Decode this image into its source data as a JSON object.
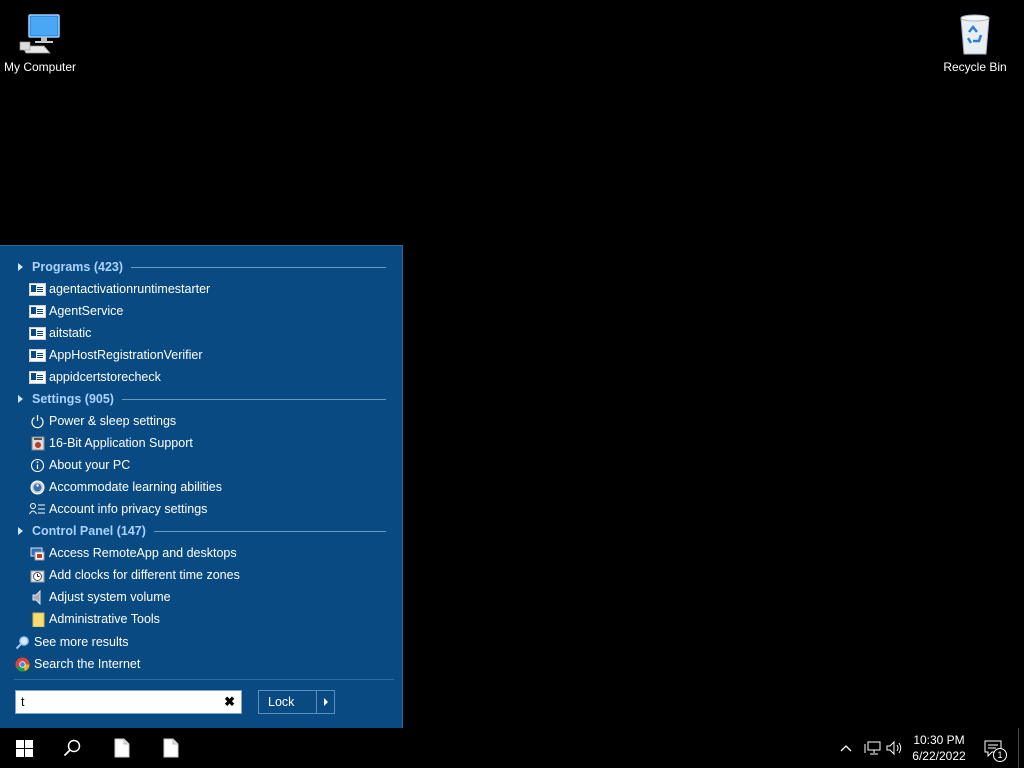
{
  "desktop": {
    "icons": [
      {
        "label": "My Computer",
        "icon": "computer-icon"
      },
      {
        "label": "Recycle Bin",
        "icon": "recycle-bin-icon"
      }
    ]
  },
  "start_menu": {
    "sections": [
      {
        "header": "Programs (423)",
        "items": [
          {
            "label": "agentactivationruntimestarter",
            "icon": "app-icon"
          },
          {
            "label": "AgentService",
            "icon": "app-icon"
          },
          {
            "label": "aitstatic",
            "icon": "app-icon"
          },
          {
            "label": "AppHostRegistrationVerifier",
            "icon": "app-icon"
          },
          {
            "label": "appidcertstorecheck",
            "icon": "app-icon"
          }
        ]
      },
      {
        "header": "Settings (905)",
        "items": [
          {
            "label": "Power & sleep settings",
            "icon": "power-icon"
          },
          {
            "label": "16-Bit Application Support",
            "icon": "legacy-app-icon"
          },
          {
            "label": "About your PC",
            "icon": "info-icon"
          },
          {
            "label": "Accommodate learning abilities",
            "icon": "accessibility-icon"
          },
          {
            "label": "Account info privacy settings",
            "icon": "account-privacy-icon"
          }
        ]
      },
      {
        "header": "Control Panel (147)",
        "items": [
          {
            "label": "Access RemoteApp and desktops",
            "icon": "remoteapp-icon"
          },
          {
            "label": "Add clocks for different time zones",
            "icon": "clock-icon"
          },
          {
            "label": "Adjust system volume",
            "icon": "speaker-icon"
          },
          {
            "label": "Administrative Tools",
            "icon": "folder-icon"
          }
        ]
      }
    ],
    "see_more": "See more results",
    "search_internet": "Search the Internet",
    "search_value": "t",
    "lock_label": "Lock"
  },
  "taskbar": {
    "time": "10:30 PM",
    "date": "6/22/2022",
    "notification_count": "1"
  },
  "colors": {
    "menu_bg": "#0a4a82",
    "section_header": "#a9d2ff"
  }
}
